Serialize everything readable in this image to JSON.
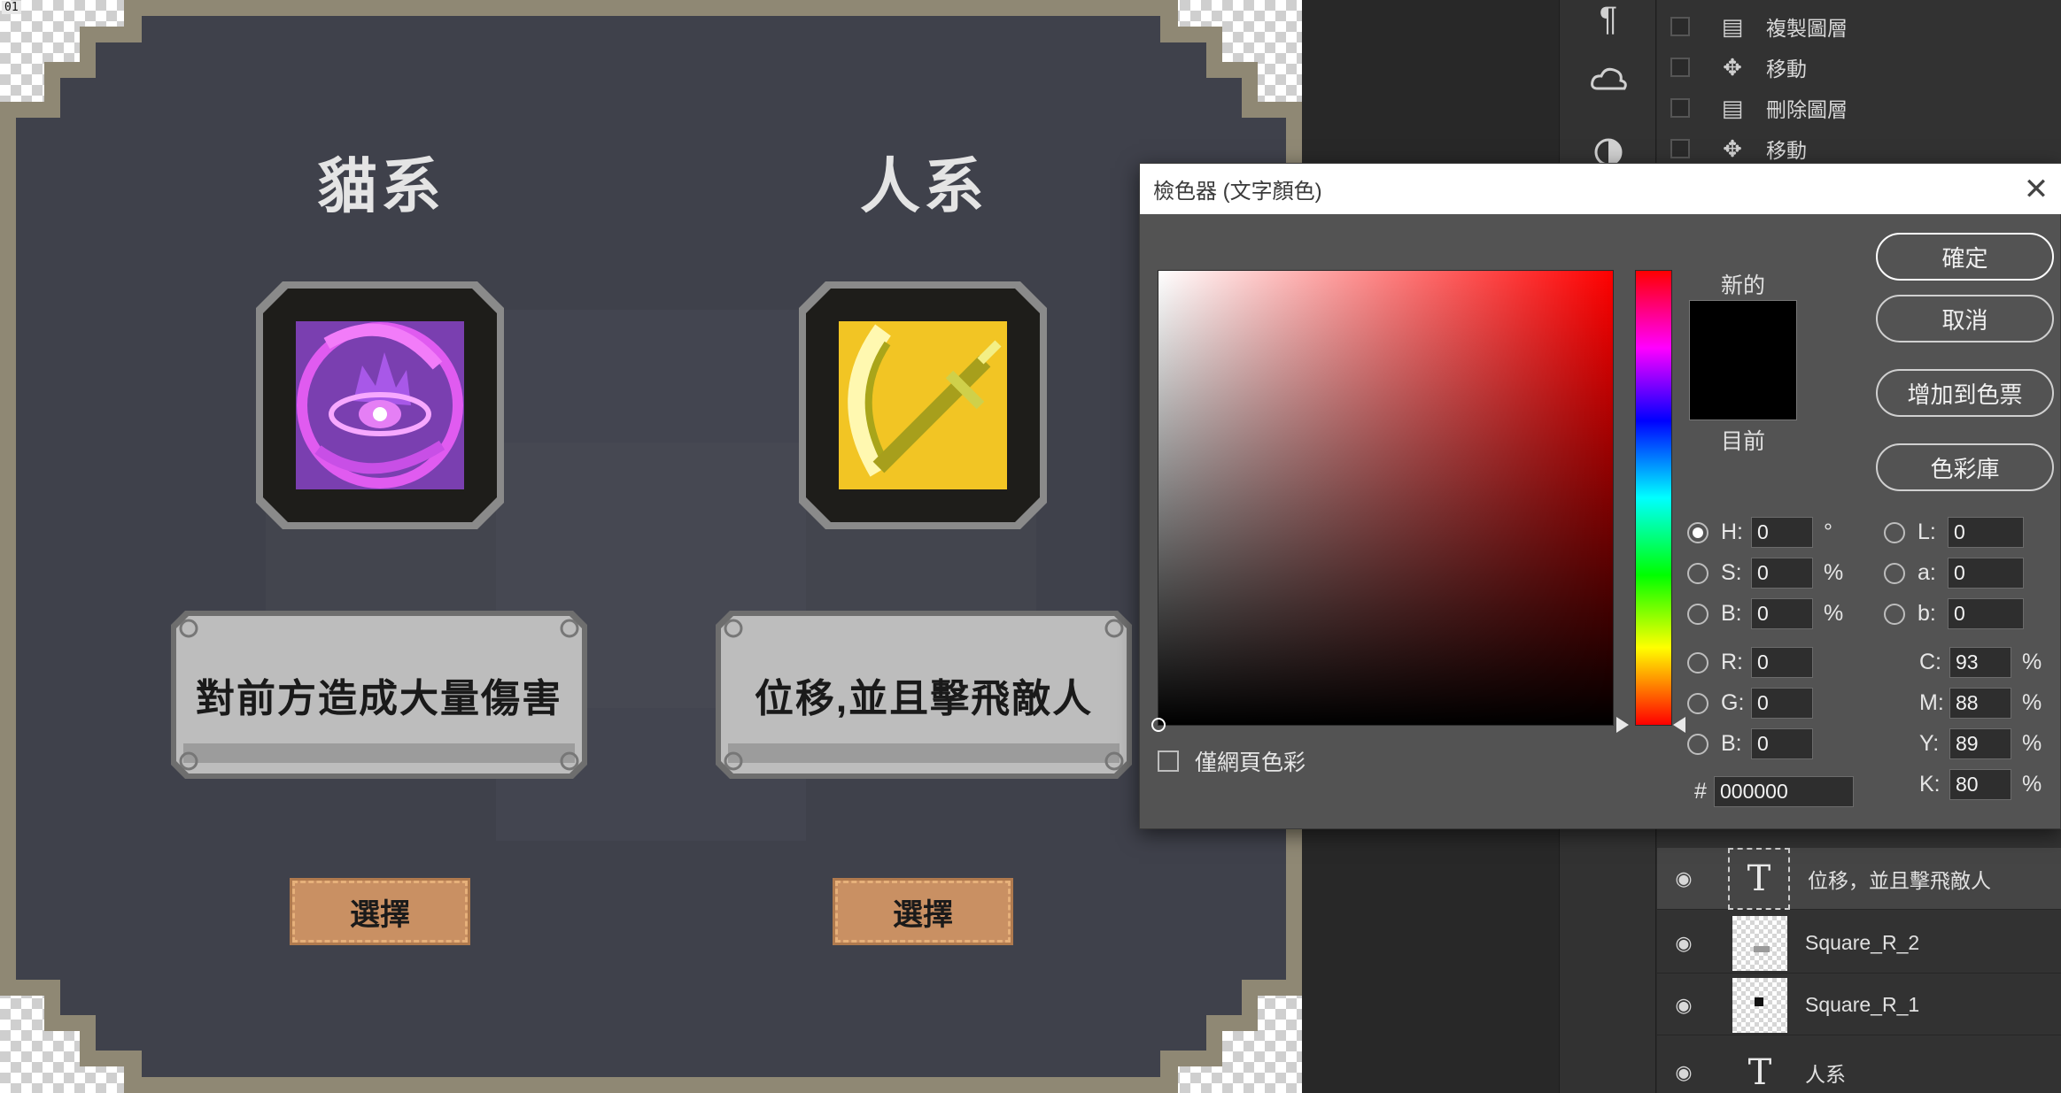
{
  "canvas": {
    "doc_badge": "01",
    "left_panel": {
      "title": "貓系",
      "description": "對前方造成大量傷害",
      "select_label": "選擇"
    },
    "right_panel": {
      "title": "人系",
      "description": "位移,並且擊飛敵人",
      "select_label": "選擇"
    }
  },
  "history": {
    "items": [
      {
        "icon": "document-icon",
        "label": "複製圖層"
      },
      {
        "icon": "move-icon",
        "label": "移動"
      },
      {
        "icon": "document-icon",
        "label": "刪除圖層"
      },
      {
        "icon": "move-icon",
        "label": "移動"
      }
    ]
  },
  "layers": {
    "items": [
      {
        "type": "text",
        "label": "位移，並且擊飛敵人",
        "selected": true
      },
      {
        "type": "image",
        "label": "Square_R_2"
      },
      {
        "type": "image",
        "label": "Square_R_1"
      },
      {
        "type": "text",
        "label": "人系"
      }
    ]
  },
  "picker": {
    "title": "檢色器 (文字顏色)",
    "new_label": "新的",
    "current_label": "目前",
    "new_color": "#000000",
    "current_color": "#000000",
    "web_only_label": "僅網頁色彩",
    "buttons": {
      "ok": "確定",
      "cancel": "取消",
      "add_swatch": "增加到色票",
      "libraries": "色彩庫"
    },
    "hsb": {
      "h_label": "H:",
      "h": "0",
      "h_unit": "°",
      "s_label": "S:",
      "s": "0",
      "s_unit": "%",
      "b_label": "B:",
      "b": "0",
      "b_unit": "%"
    },
    "rgb": {
      "r_label": "R:",
      "r": "0",
      "g_label": "G:",
      "g": "0",
      "b_label": "B:",
      "b": "0"
    },
    "lab": {
      "l_label": "L:",
      "l": "0",
      "a_label": "a:",
      "a": "0",
      "b_label": "b:",
      "b": "0"
    },
    "cmyk": {
      "c_label": "C:",
      "c": "93",
      "m_label": "M:",
      "m": "88",
      "y_label": "Y:",
      "y": "89",
      "k_label": "K:",
      "k": "80",
      "unit": "%"
    },
    "hex_label": "#",
    "hex": "000000"
  },
  "colors": {
    "panel_bg": "#3d3f49",
    "frame_tan": "#8d8672",
    "purple_skill": "#9b4bd1",
    "yellow_skill": "#f2c21a",
    "select_button": "#c99063"
  }
}
